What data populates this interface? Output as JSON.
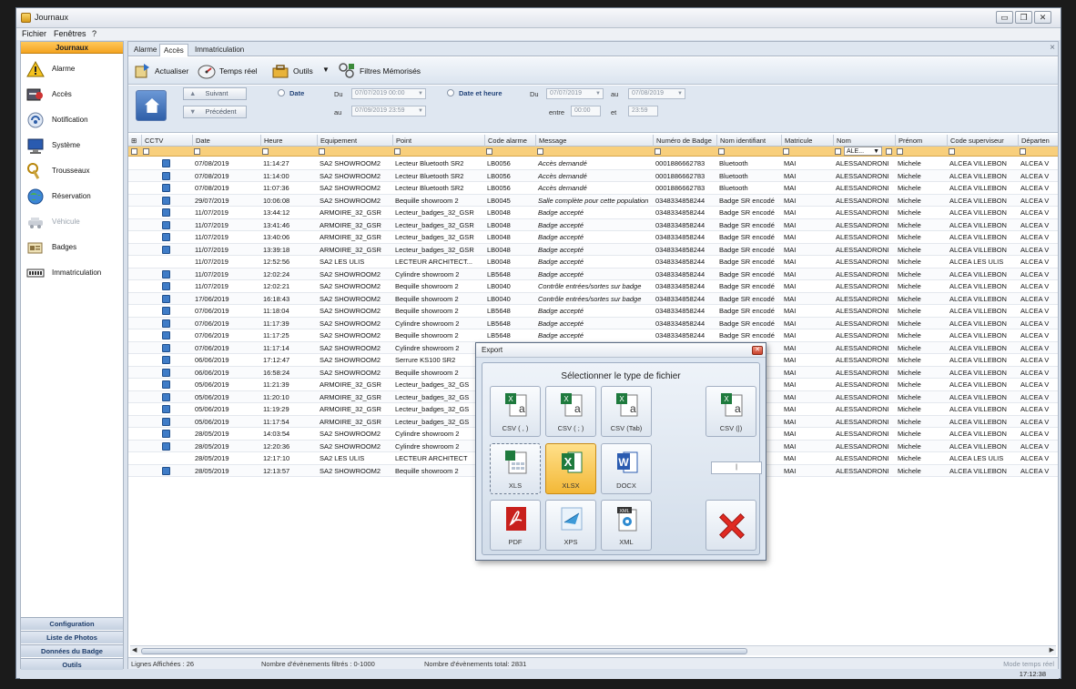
{
  "window": {
    "title": "Journaux"
  },
  "menu": [
    "Fichier",
    "Fenêtres",
    "?"
  ],
  "sidebar": {
    "header": "Journaux",
    "items": [
      {
        "label": "Alarme",
        "icon": "alarm-warning-icon",
        "enabled": true
      },
      {
        "label": "Accès",
        "icon": "access-key-icon",
        "enabled": true
      },
      {
        "label": "Notification",
        "icon": "notification-icon",
        "enabled": true
      },
      {
        "label": "Système",
        "icon": "system-monitor-icon",
        "enabled": true
      },
      {
        "label": "Trousseaux",
        "icon": "keyring-icon",
        "enabled": true
      },
      {
        "label": "Réservation",
        "icon": "reservation-globe-icon",
        "enabled": true
      },
      {
        "label": "Véhicule",
        "icon": "vehicle-icon",
        "enabled": false
      },
      {
        "label": "Badges",
        "icon": "badge-card-icon",
        "enabled": true
      },
      {
        "label": "Immatriculation",
        "icon": "license-plate-icon",
        "enabled": true
      }
    ],
    "bottom": [
      "Configuration",
      "Liste de Photos",
      "Données du Badge",
      "Outils"
    ]
  },
  "tabs": [
    {
      "label": "Alarme",
      "active": false
    },
    {
      "label": "Accès",
      "active": true
    },
    {
      "label": "Immatriculation",
      "active": false
    }
  ],
  "toolbar": {
    "refresh": "Actualiser",
    "realtime": "Temps réel",
    "tools": "Outils",
    "saved_filters": "Filtres Mémorisés"
  },
  "filters": {
    "next": "Suivant",
    "prev": "Précédent",
    "date_radio": "Date",
    "du": "Du",
    "au": "au",
    "date_from": "07/07/2019 00:00",
    "date_to": "07/09/2019 23:59",
    "datetime_radio": "Date et heure",
    "dt_du": "Du",
    "dt_au": "au",
    "dt_from": "07/07/2019",
    "dt_to": "07/08/2019",
    "entre": "entre",
    "et": "et",
    "time_from": "00:00",
    "time_to": "23:59"
  },
  "grid": {
    "columns": [
      "CCTV",
      "Date",
      "Heure",
      "Equipement",
      "Point",
      "Code alarme",
      "Message",
      "Numéro de Badge",
      "Nom identifiant",
      "Matricule",
      "Nom",
      "Prénom",
      "Code superviseur",
      "Départen"
    ],
    "name_filter": "ALE...",
    "rows": [
      {
        "cam": true,
        "date": "07/08/2019",
        "heure": "11:14:27",
        "equip": "SA2 SHOWROOM2",
        "point": "Lecteur Bluetooth SR2",
        "code": "LB0056",
        "msg": "Accès demandé",
        "badge": "0001886662783",
        "ident": "Bluetooth",
        "mat": "MAI",
        "nom": "ALESSANDRONI",
        "prenom": "Michele",
        "sup": "ALCEA VILLEBON",
        "dep": "ALCEA V"
      },
      {
        "cam": true,
        "date": "07/08/2019",
        "heure": "11:14:00",
        "equip": "SA2 SHOWROOM2",
        "point": "Lecteur Bluetooth SR2",
        "code": "LB0056",
        "msg": "Accès demandé",
        "badge": "0001886662783",
        "ident": "Bluetooth",
        "mat": "MAI",
        "nom": "ALESSANDRONI",
        "prenom": "Michele",
        "sup": "ALCEA VILLEBON",
        "dep": "ALCEA V"
      },
      {
        "cam": true,
        "date": "07/08/2019",
        "heure": "11:07:36",
        "equip": "SA2 SHOWROOM2",
        "point": "Lecteur Bluetooth SR2",
        "code": "LB0056",
        "msg": "Accès demandé",
        "badge": "0001886662783",
        "ident": "Bluetooth",
        "mat": "MAI",
        "nom": "ALESSANDRONI",
        "prenom": "Michele",
        "sup": "ALCEA VILLEBON",
        "dep": "ALCEA V"
      },
      {
        "cam": true,
        "date": "29/07/2019",
        "heure": "10:06:08",
        "equip": "SA2 SHOWROOM2",
        "point": "Bequille showroom 2",
        "code": "LB0045",
        "msg": "Salle complète pour cette population",
        "badge": "0348334858244",
        "ident": "Badge SR encodé",
        "mat": "MAI",
        "nom": "ALESSANDRONI",
        "prenom": "Michele",
        "sup": "ALCEA VILLEBON",
        "dep": "ALCEA V"
      },
      {
        "cam": true,
        "date": "11/07/2019",
        "heure": "13:44:12",
        "equip": "ARMOIRE_32_GSR",
        "point": "Lecteur_badges_32_GSR",
        "code": "LB0048",
        "msg": "Badge accepté",
        "badge": "0348334858244",
        "ident": "Badge SR encodé",
        "mat": "MAI",
        "nom": "ALESSANDRONI",
        "prenom": "Michele",
        "sup": "ALCEA VILLEBON",
        "dep": "ALCEA V"
      },
      {
        "cam": true,
        "date": "11/07/2019",
        "heure": "13:41:46",
        "equip": "ARMOIRE_32_GSR",
        "point": "Lecteur_badges_32_GSR",
        "code": "LB0048",
        "msg": "Badge accepté",
        "badge": "0348334858244",
        "ident": "Badge SR encodé",
        "mat": "MAI",
        "nom": "ALESSANDRONI",
        "prenom": "Michele",
        "sup": "ALCEA VILLEBON",
        "dep": "ALCEA V"
      },
      {
        "cam": true,
        "date": "11/07/2019",
        "heure": "13:40:06",
        "equip": "ARMOIRE_32_GSR",
        "point": "Lecteur_badges_32_GSR",
        "code": "LB0048",
        "msg": "Badge accepté",
        "badge": "0348334858244",
        "ident": "Badge SR encodé",
        "mat": "MAI",
        "nom": "ALESSANDRONI",
        "prenom": "Michele",
        "sup": "ALCEA VILLEBON",
        "dep": "ALCEA V"
      },
      {
        "cam": true,
        "date": "11/07/2019",
        "heure": "13:39:18",
        "equip": "ARMOIRE_32_GSR",
        "point": "Lecteur_badges_32_GSR",
        "code": "LB0048",
        "msg": "Badge accepté",
        "badge": "0348334858244",
        "ident": "Badge SR encodé",
        "mat": "MAI",
        "nom": "ALESSANDRONI",
        "prenom": "Michele",
        "sup": "ALCEA VILLEBON",
        "dep": "ALCEA V"
      },
      {
        "cam": false,
        "date": "11/07/2019",
        "heure": "12:52:56",
        "equip": "SA2 LES ULIS",
        "point": "LECTEUR ARCHITECT...",
        "code": "LB0048",
        "msg": "Badge accepté",
        "badge": "0348334858244",
        "ident": "Badge SR encodé",
        "mat": "MAI",
        "nom": "ALESSANDRONI",
        "prenom": "Michele",
        "sup": "ALCEA LES ULIS",
        "dep": "ALCEA V"
      },
      {
        "cam": true,
        "date": "11/07/2019",
        "heure": "12:02:24",
        "equip": "SA2 SHOWROOM2",
        "point": "Cylindre showroom 2",
        "code": "LB5648",
        "msg": "Badge accepté",
        "badge": "0348334858244",
        "ident": "Badge SR encodé",
        "mat": "MAI",
        "nom": "ALESSANDRONI",
        "prenom": "Michele",
        "sup": "ALCEA VILLEBON",
        "dep": "ALCEA V"
      },
      {
        "cam": true,
        "date": "11/07/2019",
        "heure": "12:02:21",
        "equip": "SA2 SHOWROOM2",
        "point": "Bequille showroom 2",
        "code": "LB0040",
        "msg": "Contrôle entrées/sortes sur badge",
        "badge": "0348334858244",
        "ident": "Badge SR encodé",
        "mat": "MAI",
        "nom": "ALESSANDRONI",
        "prenom": "Michele",
        "sup": "ALCEA VILLEBON",
        "dep": "ALCEA V"
      },
      {
        "cam": true,
        "date": "17/06/2019",
        "heure": "16:18:43",
        "equip": "SA2 SHOWROOM2",
        "point": "Bequille showroom 2",
        "code": "LB0040",
        "msg": "Contrôle entrées/sortes sur badge",
        "badge": "0348334858244",
        "ident": "Badge SR encodé",
        "mat": "MAI",
        "nom": "ALESSANDRONI",
        "prenom": "Michele",
        "sup": "ALCEA VILLEBON",
        "dep": "ALCEA V"
      },
      {
        "cam": true,
        "date": "07/06/2019",
        "heure": "11:18:04",
        "equip": "SA2 SHOWROOM2",
        "point": "Bequille showroom 2",
        "code": "LB5648",
        "msg": "Badge accepté",
        "badge": "0348334858244",
        "ident": "Badge SR encodé",
        "mat": "MAI",
        "nom": "ALESSANDRONI",
        "prenom": "Michele",
        "sup": "ALCEA VILLEBON",
        "dep": "ALCEA V"
      },
      {
        "cam": true,
        "date": "07/06/2019",
        "heure": "11:17:39",
        "equip": "SA2 SHOWROOM2",
        "point": "Cylindre showroom 2",
        "code": "LB5648",
        "msg": "Badge accepté",
        "badge": "0348334858244",
        "ident": "Badge SR encodé",
        "mat": "MAI",
        "nom": "ALESSANDRONI",
        "prenom": "Michele",
        "sup": "ALCEA VILLEBON",
        "dep": "ALCEA V"
      },
      {
        "cam": true,
        "date": "07/06/2019",
        "heure": "11:17:25",
        "equip": "SA2 SHOWROOM2",
        "point": "Bequille showroom 2",
        "code": "LB5648",
        "msg": "Badge accepté",
        "badge": "0348334858244",
        "ident": "Badge SR encodé",
        "mat": "MAI",
        "nom": "ALESSANDRONI",
        "prenom": "Michele",
        "sup": "ALCEA VILLEBON",
        "dep": "ALCEA V"
      },
      {
        "cam": true,
        "date": "07/06/2019",
        "heure": "11:17:14",
        "equip": "SA2 SHOWROOM2",
        "point": "Cylindre showroom 2",
        "code": "",
        "msg": "",
        "badge": "",
        "ident": "ncodé",
        "mat": "MAI",
        "nom": "ALESSANDRONI",
        "prenom": "Michele",
        "sup": "ALCEA VILLEBON",
        "dep": "ALCEA V"
      },
      {
        "cam": true,
        "date": "06/06/2019",
        "heure": "17:12:47",
        "equip": "SA2 SHOWROOM2",
        "point": "Serrure KS100 SR2",
        "code": "",
        "msg": "",
        "badge": "",
        "ident": "ncodé",
        "mat": "MAI",
        "nom": "ALESSANDRONI",
        "prenom": "Michele",
        "sup": "ALCEA VILLEBON",
        "dep": "ALCEA V"
      },
      {
        "cam": true,
        "date": "06/06/2019",
        "heure": "16:58:24",
        "equip": "SA2 SHOWROOM2",
        "point": "Bequille showroom 2",
        "code": "",
        "msg": "",
        "badge": "",
        "ident": "ncodé",
        "mat": "MAI",
        "nom": "ALESSANDRONI",
        "prenom": "Michele",
        "sup": "ALCEA VILLEBON",
        "dep": "ALCEA V"
      },
      {
        "cam": true,
        "date": "05/06/2019",
        "heure": "11:21:39",
        "equip": "ARMOIRE_32_GSR",
        "point": "Lecteur_badges_32_GS",
        "code": "",
        "msg": "",
        "badge": "",
        "ident": "ncodé",
        "mat": "MAI",
        "nom": "ALESSANDRONI",
        "prenom": "Michele",
        "sup": "ALCEA VILLEBON",
        "dep": "ALCEA V"
      },
      {
        "cam": true,
        "date": "05/06/2019",
        "heure": "11:20:10",
        "equip": "ARMOIRE_32_GSR",
        "point": "Lecteur_badges_32_GS",
        "code": "",
        "msg": "",
        "badge": "",
        "ident": "ncodé",
        "mat": "MAI",
        "nom": "ALESSANDRONI",
        "prenom": "Michele",
        "sup": "ALCEA VILLEBON",
        "dep": "ALCEA V"
      },
      {
        "cam": true,
        "date": "05/06/2019",
        "heure": "11:19:29",
        "equip": "ARMOIRE_32_GSR",
        "point": "Lecteur_badges_32_GS",
        "code": "",
        "msg": "",
        "badge": "",
        "ident": "ncodé",
        "mat": "MAI",
        "nom": "ALESSANDRONI",
        "prenom": "Michele",
        "sup": "ALCEA VILLEBON",
        "dep": "ALCEA V"
      },
      {
        "cam": true,
        "date": "05/06/2019",
        "heure": "11:17:54",
        "equip": "ARMOIRE_32_GSR",
        "point": "Lecteur_badges_32_GS",
        "code": "",
        "msg": "",
        "badge": "",
        "ident": "ncodé",
        "mat": "MAI",
        "nom": "ALESSANDRONI",
        "prenom": "Michele",
        "sup": "ALCEA VILLEBON",
        "dep": "ALCEA V"
      },
      {
        "cam": true,
        "date": "28/05/2019",
        "heure": "14:03:54",
        "equip": "SA2 SHOWROOM2",
        "point": "Cylindre showroom 2",
        "code": "",
        "msg": "",
        "badge": "",
        "ident": "ncodé",
        "mat": "MAI",
        "nom": "ALESSANDRONI",
        "prenom": "Michele",
        "sup": "ALCEA VILLEBON",
        "dep": "ALCEA V"
      },
      {
        "cam": true,
        "date": "28/05/2019",
        "heure": "12:20:36",
        "equip": "SA2 SHOWROOM2",
        "point": "Cylindre showroom 2",
        "code": "",
        "msg": "",
        "badge": "",
        "ident": "ncodé",
        "mat": "MAI",
        "nom": "ALESSANDRONI",
        "prenom": "Michele",
        "sup": "ALCEA VILLEBON",
        "dep": "ALCEA V"
      },
      {
        "cam": false,
        "date": "28/05/2019",
        "heure": "12:17:10",
        "equip": "SA2 LES ULIS",
        "point": "LECTEUR ARCHITECT",
        "code": "",
        "msg": "",
        "badge": "",
        "ident": "ncodé",
        "mat": "MAI",
        "nom": "ALESSANDRONI",
        "prenom": "Michele",
        "sup": "ALCEA LES ULIS",
        "dep": "ALCEA V"
      },
      {
        "cam": true,
        "date": "28/05/2019",
        "heure": "12:13:57",
        "equip": "SA2 SHOWROOM2",
        "point": "Bequille showroom 2",
        "code": "",
        "msg": "",
        "badge": "",
        "ident": "ncodé",
        "mat": "MAI",
        "nom": "ALESSANDRONI",
        "prenom": "Michele",
        "sup": "ALCEA VILLEBON",
        "dep": "ALCEA V"
      }
    ]
  },
  "status": {
    "shown": "Lignes Affichées : 26",
    "filtered": "Nombre d'évènements filtrés : 0-1000",
    "total": "Nombre d'évènements total: 2831",
    "mode": "Mode temps réel",
    "clock": "17:12:38"
  },
  "export_dialog": {
    "title": "Export",
    "heading": "Sélectionner le type de fichier",
    "buttons": [
      {
        "label": "CSV ( , )",
        "icon": "csv-comma-icon"
      },
      {
        "label": "CSV ( ; )",
        "icon": "csv-semicolon-icon"
      },
      {
        "label": "CSV (Tab)",
        "icon": "csv-tab-icon"
      },
      {
        "label": "CSV (|)",
        "icon": "csv-custom-icon"
      },
      {
        "label": "XLS",
        "icon": "xls-icon"
      },
      {
        "label": "XLSX",
        "icon": "xlsx-icon"
      },
      {
        "label": "DOCX",
        "icon": "docx-icon"
      },
      {
        "label": "PDF",
        "icon": "pdf-icon"
      },
      {
        "label": "XPS",
        "icon": "xps-icon"
      },
      {
        "label": "XML",
        "icon": "xml-icon"
      }
    ],
    "separator_value": "|",
    "selected": "XLSX",
    "cancel_icon": "cancel-x-icon"
  }
}
